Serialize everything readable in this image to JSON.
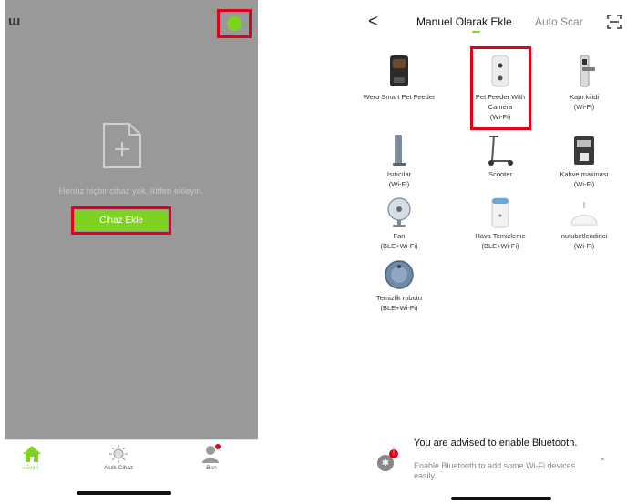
{
  "left": {
    "app_logo": "ɯ",
    "empty_text": "Henüz hiçbir cihaz yok, lütfen ekleyin.",
    "add_device_label": "Cihaz Ekle",
    "tabs": [
      {
        "label": "Evim",
        "icon": "home-icon"
      },
      {
        "label": "Akıllı Cihaz",
        "icon": "sun-icon"
      },
      {
        "label": "Ben",
        "icon": "person-icon"
      }
    ],
    "accent": "#7ed321",
    "highlight": "#e0001b"
  },
  "right": {
    "back_glyph": "<",
    "tab_manual": "Manuel Olarak Ekle",
    "tab_auto": "Auto Scar",
    "devices": [
      {
        "name": "Wero Smart Pet Feeder",
        "protocol": "",
        "icon": "pet-feeder-icon"
      },
      {
        "name": "Pet Feeder With Camera",
        "protocol": "(Wi-Fi)",
        "icon": "pet-feeder-camera-icon"
      },
      {
        "name": "Kapı kilidi",
        "protocol": "(Wi-Fi)",
        "icon": "door-lock-icon"
      },
      {
        "name": "Isıtıcılar",
        "protocol": "(Wi-Fi)",
        "icon": "heater-icon"
      },
      {
        "name": "Scooter",
        "protocol": "",
        "icon": "scooter-icon"
      },
      {
        "name": "Kahve makinası",
        "protocol": "(Wi-Fi)",
        "icon": "coffee-machine-icon"
      },
      {
        "name": "Fan",
        "protocol": "(BLE+Wi-Fi)",
        "icon": "fan-icon"
      },
      {
        "name": "Hava Temizleme",
        "protocol": "(BLE+Wi-Fi)",
        "icon": "air-purifier-icon"
      },
      {
        "name": "nutubetlendirici",
        "protocol": "(Wi-Fi)",
        "icon": "humidifier-icon"
      },
      {
        "name": "Temizlik robotu",
        "protocol": "(BLE+Wi-Fi)",
        "icon": "robot-vacuum-icon"
      }
    ],
    "bluetooth": {
      "title": "You are advised to enable Bluetooth.",
      "subtitle": "Enable Bluetooth to add some Wi-Fi devices easily.",
      "badge": "!"
    }
  }
}
